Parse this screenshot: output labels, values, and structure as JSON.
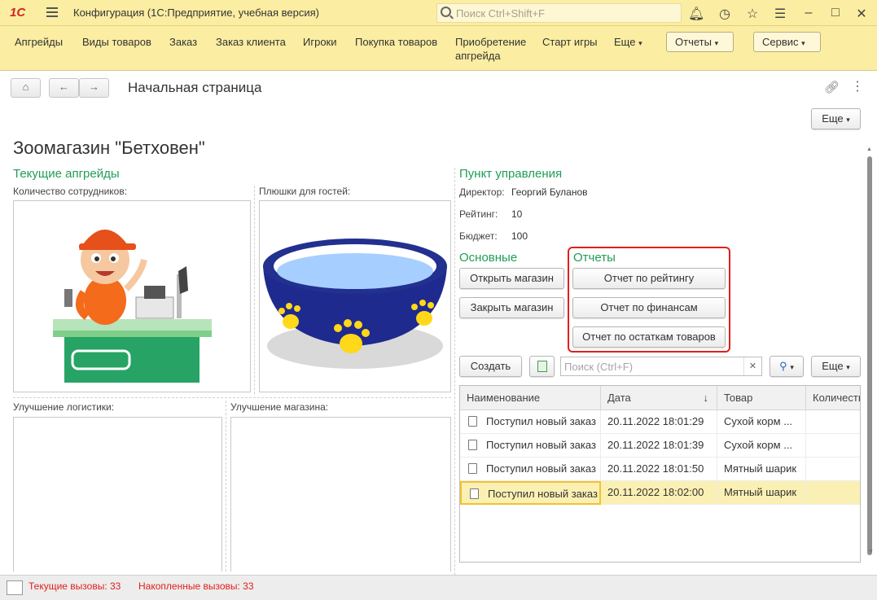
{
  "titlebar": {
    "logo": "1С",
    "title": "Конфигурация  (1С:Предприятие, учебная версия)",
    "search_placeholder": "Поиск Ctrl+Shift+F"
  },
  "menu": {
    "items": [
      "Апгрейды",
      "Виды товаров",
      "Заказ",
      "Заказ клиента",
      "Игроки",
      "Покупка товаров",
      "Приобретение апгрейда",
      "Старт игры",
      "Еще"
    ],
    "reports_button": "Отчеты",
    "service_button": "Сервис"
  },
  "page": {
    "title": "Начальная страница",
    "more_button": "Еще",
    "heading": "Зоомагазин \"Бетховен\""
  },
  "upgrades": {
    "title": "Текущие апгрейды",
    "staff_label": "Количество сотрудников:",
    "snacks_label": "Плюшки для гостей:",
    "logistics_label": "Улучшение логистики:",
    "store_label": "Улучшение магазина:"
  },
  "control": {
    "title": "Пункт управления",
    "director_label": "Директор:",
    "director_value": "Георгий Буланов",
    "rating_label": "Рейтинг:",
    "rating_value": "10",
    "budget_label": "Бюджет:",
    "budget_value": "100"
  },
  "main_group": {
    "title": "Основные",
    "open_store": "Открыть магазин",
    "close_store": "Закрыть магазин"
  },
  "reports_group": {
    "title": "Отчеты",
    "rating_report": "Отчет по рейтингу",
    "finance_report": "Отчет по финансам",
    "stock_report": "Отчет по остаткам товаров"
  },
  "list_toolbar": {
    "create": "Создать",
    "search_placeholder": "Поиск (Ctrl+F)",
    "more": "Еще"
  },
  "table": {
    "columns": [
      "Наименование",
      "Дата",
      "Товар",
      "Количество"
    ],
    "rows": [
      {
        "name": "Поступил новый заказ",
        "date": "20.11.2022 18:01:29",
        "product": "Сухой корм ...",
        "qty": ""
      },
      {
        "name": "Поступил новый заказ",
        "date": "20.11.2022 18:01:39",
        "product": "Сухой корм ...",
        "qty": ""
      },
      {
        "name": "Поступил новый заказ",
        "date": "20.11.2022 18:01:50",
        "product": "Мятный шарик",
        "qty": ""
      },
      {
        "name": "Поступил новый заказ",
        "date": "20.11.2022 18:02:00",
        "product": "Мятный шарик",
        "qty": ""
      }
    ],
    "selected_row": 3
  },
  "status": {
    "current_calls": "Текущие вызовы: 33",
    "total_calls": "Накопленные вызовы: 33"
  },
  "colors": {
    "titlebar_bg": "#fbeda2",
    "accent_green": "#1f9d55",
    "highlight_red": "#e0201b",
    "selected_row_bg": "#fbf0b3",
    "status_red": "#e0201b"
  }
}
